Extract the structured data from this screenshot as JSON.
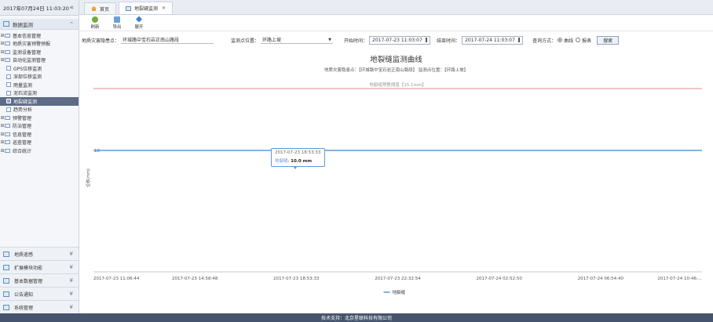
{
  "sidebar": {
    "date": "2017年07月24日 11:03:20",
    "collapse_icon": "double-chevron-left",
    "section_title": "数据监测",
    "tree": [
      {
        "label": "基本信息管理",
        "type": "folder"
      },
      {
        "label": "地质灾害预警预报",
        "type": "folder"
      },
      {
        "label": "监测设备管理",
        "type": "folder"
      },
      {
        "label": "自动化监测管理",
        "type": "folder"
      },
      {
        "label": "GPS位移监测",
        "type": "leaf"
      },
      {
        "label": "深部位移监测",
        "type": "leaf"
      },
      {
        "label": "雨量监测",
        "type": "leaf"
      },
      {
        "label": "泥石流监测",
        "type": "leaf"
      },
      {
        "label": "地裂缝监测",
        "type": "leaf",
        "active": true
      },
      {
        "label": "趋势分析",
        "type": "leaf"
      },
      {
        "label": "预警管理",
        "type": "folder"
      },
      {
        "label": "防治管理",
        "type": "folder"
      },
      {
        "label": "信息管理",
        "type": "folder"
      },
      {
        "label": "巡查管理",
        "type": "folder"
      },
      {
        "label": "综合统计",
        "type": "folder"
      }
    ],
    "accordion": [
      {
        "label": "地质遥感"
      },
      {
        "label": "扩展模块功能"
      },
      {
        "label": "基本数据管理"
      },
      {
        "label": "公告通知"
      },
      {
        "label": "系统管理"
      }
    ]
  },
  "tabs": [
    {
      "label": "首页",
      "icon": "home-icon"
    },
    {
      "label": "地裂缝监测",
      "icon": "page-icon",
      "active": true
    }
  ],
  "toolbar": {
    "refresh_label": "刷新",
    "export_label": "导出",
    "expand_label": "展开"
  },
  "filters": {
    "hazard_label": "地质灾害隐患点：",
    "hazard_value": "环城路中宝石岩正南山路段",
    "position_label": "监测点位置：",
    "position_value": "环路上坡",
    "start_label": "开始时间：",
    "start_value": "2017-07-23 11:03:07",
    "end_label": "结束时间：",
    "end_value": "2017-07-24 11:03:07",
    "mode_label": "查询方式：",
    "mode_options": [
      "曲线",
      "报表"
    ],
    "query_label": "搜索"
  },
  "chart_data": {
    "type": "line",
    "title": "地裂缝监测曲线",
    "subtitle": "地质灾害隐患点：【环城路中宝石岩正南山路段】 监测点位置：【环路上坡】",
    "x": [
      "2017-07-23 11:06:44",
      "2017-07-23 14:58:48",
      "2017-07-23 18:53:33",
      "2017-07-23 22:32:54",
      "2017-07-24 02:52:50",
      "2017-07-24 06:54:40",
      "2017-07-24 10:46:..."
    ],
    "series": [
      {
        "name": "地裂缝",
        "values": [
          10,
          10,
          10,
          10,
          10,
          10,
          10
        ],
        "color": "#5b9bd5"
      }
    ],
    "ylabel": "位移(mm)",
    "ylim": [
      0,
      15.1
    ],
    "yticks": [
      10
    ],
    "threshold": {
      "label": "地裂缝预警阈值【15.1mm】",
      "value": 15.1,
      "color": "#e08c8c"
    },
    "grid": false,
    "legend": "bottom-center",
    "tooltip": {
      "time": "2017-07-23 18:53:33",
      "series_name": "地裂缝",
      "value_text": "10.0 mm"
    }
  },
  "footer": {
    "text": "技术支持：北京星联科技有限公司"
  }
}
